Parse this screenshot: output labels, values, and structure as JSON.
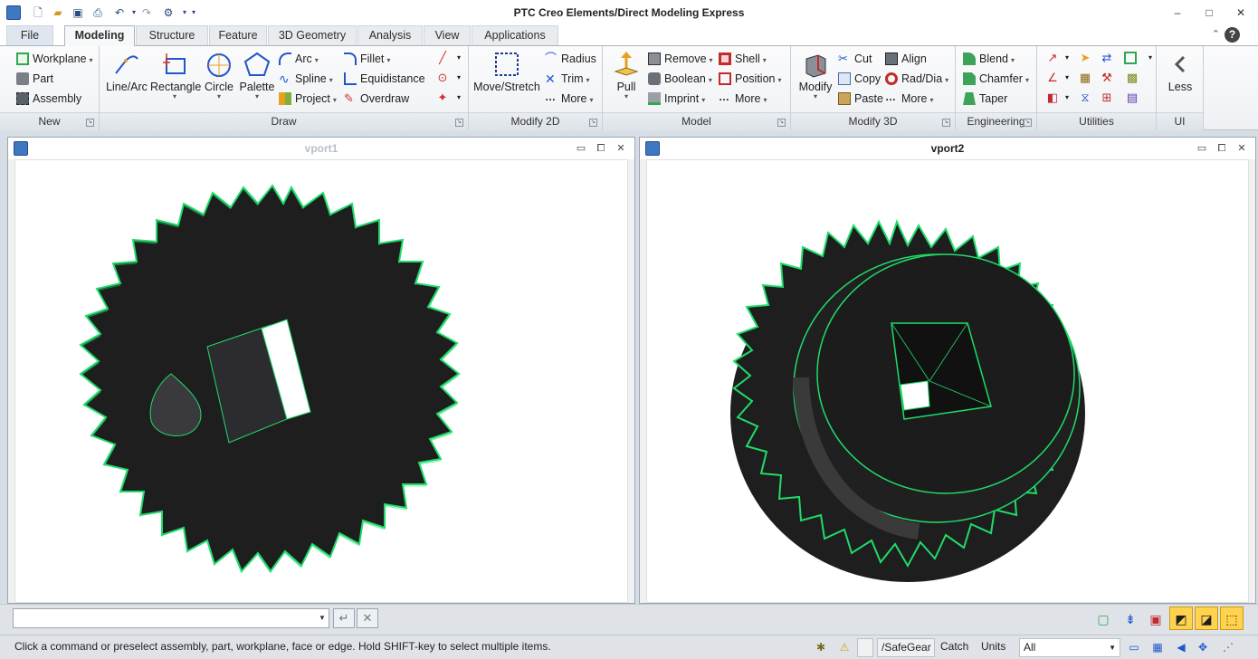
{
  "window": {
    "title": "PTC Creo Elements/Direct Modeling Express",
    "controls": [
      "–",
      "□",
      "✕"
    ]
  },
  "quick_access": [
    "new-icon",
    "open-icon",
    "save-icon",
    "print-preview-icon",
    "undo-icon",
    "redo-icon",
    "settings-icon"
  ],
  "tabs": [
    {
      "label": "File"
    },
    {
      "label": "Modeling",
      "active": true
    },
    {
      "label": "Structure"
    },
    {
      "label": "Feature"
    },
    {
      "label": "3D Geometry"
    },
    {
      "label": "Analysis"
    },
    {
      "label": "View"
    },
    {
      "label": "Applications"
    }
  ],
  "help": {
    "label": "?"
  },
  "ribbon": {
    "new": {
      "label": "New",
      "workplane": "Workplane",
      "part": "Part",
      "assembly": "Assembly"
    },
    "draw": {
      "label": "Draw",
      "line_arc": "Line/Arc",
      "rectangle": "Rectangle",
      "circle": "Circle",
      "palette": "Palette",
      "arc": "Arc",
      "spline": "Spline",
      "project": "Project",
      "fillet": "Fillet",
      "equidistance": "Equidistance",
      "overdraw": "Overdraw"
    },
    "modify2d": {
      "label": "Modify 2D",
      "move_stretch": "Move/Stretch",
      "radius": "Radius",
      "trim": "Trim",
      "more": "More"
    },
    "model": {
      "label": "Model",
      "pull": "Pull",
      "remove": "Remove",
      "boolean": "Boolean",
      "imprint": "Imprint",
      "shell": "Shell",
      "position": "Position",
      "more": "More"
    },
    "modify3d": {
      "label": "Modify 3D",
      "modify": "Modify",
      "cut": "Cut",
      "copy": "Copy",
      "paste": "Paste",
      "align": "Align",
      "rad_dia": "Rad/Dia",
      "more": "More"
    },
    "engineering": {
      "label": "Engineering",
      "blend": "Blend",
      "chamfer": "Chamfer",
      "taper": "Taper"
    },
    "utilities": {
      "label": "Utilities"
    },
    "ui": {
      "label": "UI",
      "less": "Less"
    }
  },
  "viewports": [
    {
      "title": "vport1",
      "active": false
    },
    {
      "title": "vport2",
      "active": true
    }
  ],
  "command_bar": {
    "value": "",
    "accept": "↵",
    "cancel": "✕"
  },
  "status": {
    "message": "Click a command or preselect assembly, part, workplane, face or edge. Hold SHIFT-key to select multiple items.",
    "part_path": "/SafeGear",
    "catch": "Catch",
    "units": "Units",
    "filter": "All"
  },
  "colors": {
    "gear_body": "#1e1e1e",
    "gear_edge": "#1fdc6a",
    "accent": "#ffd34d"
  }
}
